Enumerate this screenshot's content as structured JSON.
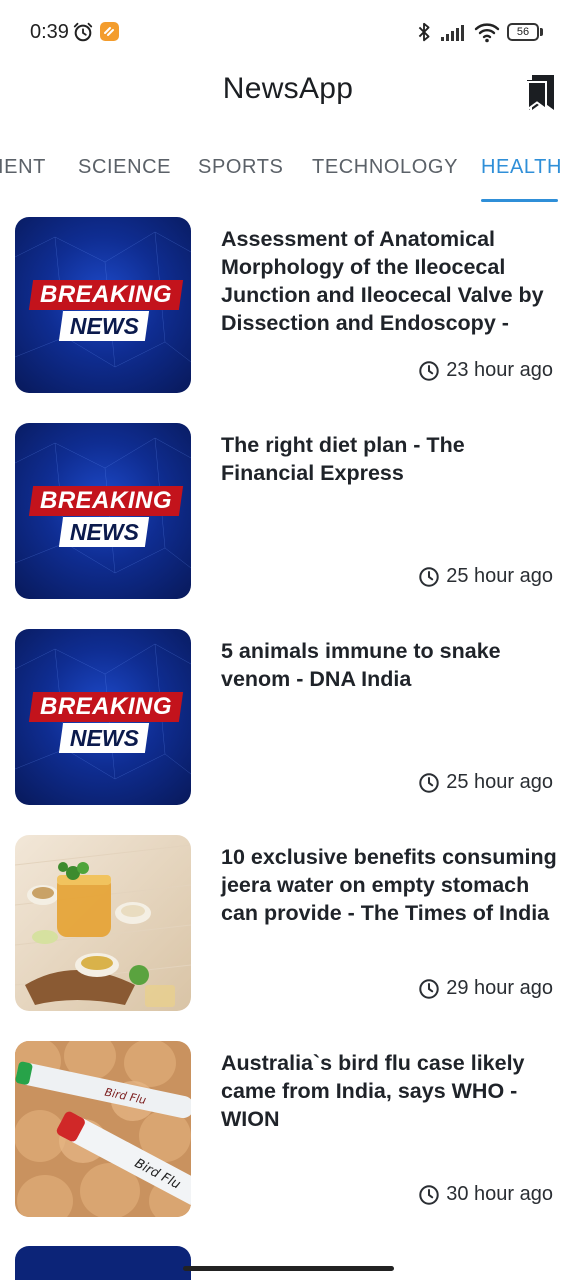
{
  "status_bar": {
    "time": "0:39",
    "battery_level": "56",
    "icons": [
      "alarm-icon",
      "app-notification-icon",
      "bluetooth-icon",
      "signal-icon",
      "wifi-icon",
      "battery-icon"
    ]
  },
  "app_bar": {
    "title": "NewsApp",
    "bookmark_icon": "bookmark-icon"
  },
  "tabs": [
    {
      "label": "ENTERTAINMENT",
      "visible_text": "IENT",
      "active": false
    },
    {
      "label": "SCIENCE",
      "active": false
    },
    {
      "label": "SPORTS",
      "active": false
    },
    {
      "label": "TECHNOLOGY",
      "active": false
    },
    {
      "label": "HEALTH",
      "active": true
    }
  ],
  "tabs_display": [
    "IENT",
    "SCIENCE",
    "SPORTS",
    "TECHNOLOGY",
    "HEALTH"
  ],
  "colors": {
    "accent": "#2f8fd8",
    "breaking_red": "#c3131c",
    "breaking_blue": "#0f2d92"
  },
  "articles": [
    {
      "headline": "Assessment of Anatomical Morphology of the Ileocecal Junction and Ileocecal Valve by Dissection and Endoscopy -",
      "time": "23 hour ago",
      "thumbnail": "breaking-news-image",
      "thumb_text_1": "BREAKING",
      "thumb_text_2": "NEWS"
    },
    {
      "headline": "The right diet plan - The Financial Express",
      "time": "25 hour ago",
      "thumbnail": "breaking-news-image",
      "thumb_text_1": "BREAKING",
      "thumb_text_2": "NEWS"
    },
    {
      "headline": "5 animals immune to snake venom - DNA India",
      "time": "25 hour ago",
      "thumbnail": "breaking-news-image",
      "thumb_text_1": "BREAKING",
      "thumb_text_2": "NEWS"
    },
    {
      "headline": "10 exclusive benefits consuming jeera water on empty stomach can provide - The Times of India",
      "time": "29 hour ago",
      "thumbnail": "jeera-water-photo"
    },
    {
      "headline": "Australia`s bird flu case likely came from India, says WHO - WION",
      "time": "30 hour ago",
      "thumbnail": "bird-flu-eggs-photo"
    }
  ]
}
